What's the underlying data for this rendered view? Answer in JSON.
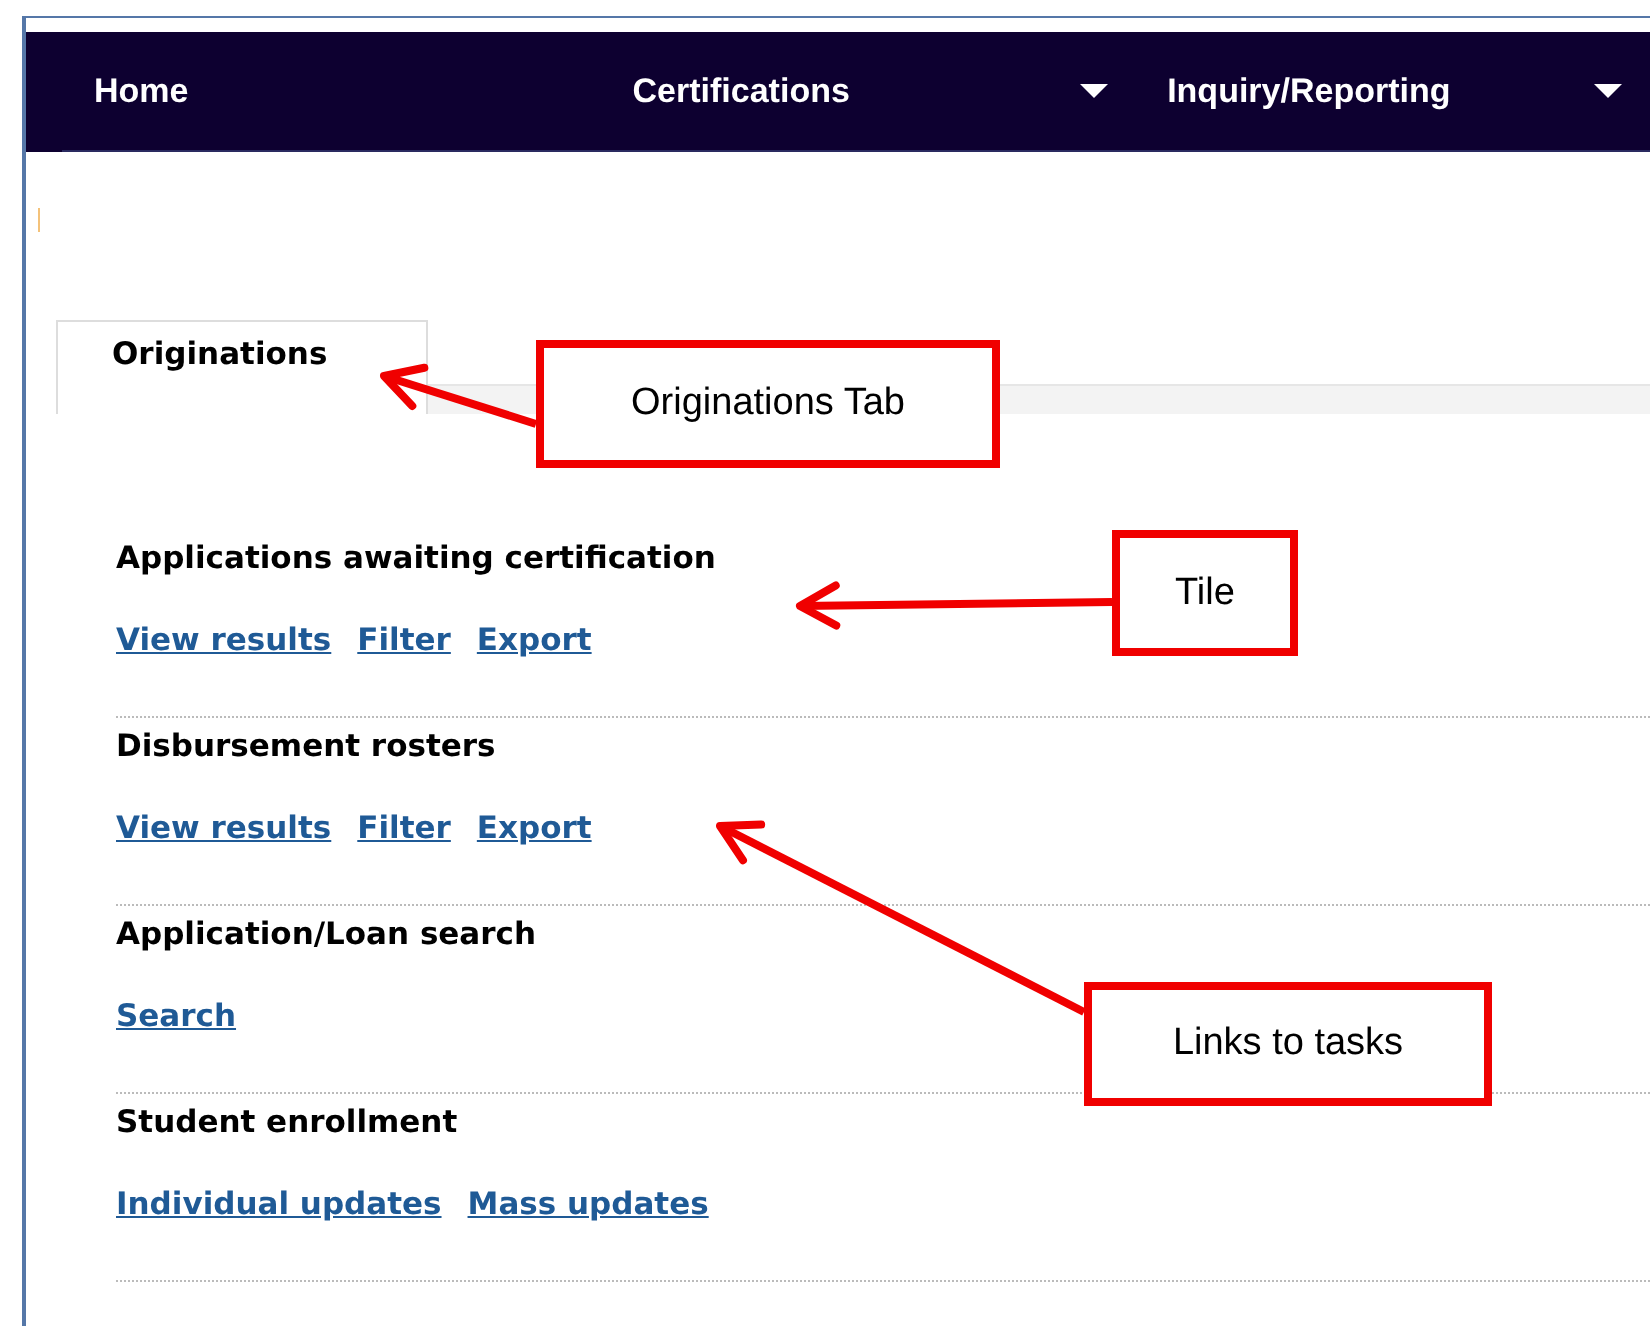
{
  "nav": [
    {
      "label": "Home",
      "dropdown": false
    },
    {
      "label": "Certifications",
      "dropdown": true
    },
    {
      "label": "Inquiry/Reporting",
      "dropdown": true
    }
  ],
  "tabs": [
    {
      "label": "Originations",
      "selected": true
    }
  ],
  "tiles": [
    {
      "title": "Applications awaiting certification",
      "links": [
        "View results",
        "Filter",
        "Export"
      ]
    },
    {
      "title": "Disbursement rosters",
      "links": [
        "View results",
        "Filter",
        "Export"
      ]
    },
    {
      "title": "Application/Loan search",
      "links": [
        "Search"
      ]
    },
    {
      "title": "Student enrollment",
      "links": [
        "Individual updates",
        "Mass updates"
      ]
    }
  ],
  "callouts": [
    {
      "label": "Originations Tab"
    },
    {
      "label": "Tile"
    },
    {
      "label": "Links to tasks"
    }
  ]
}
